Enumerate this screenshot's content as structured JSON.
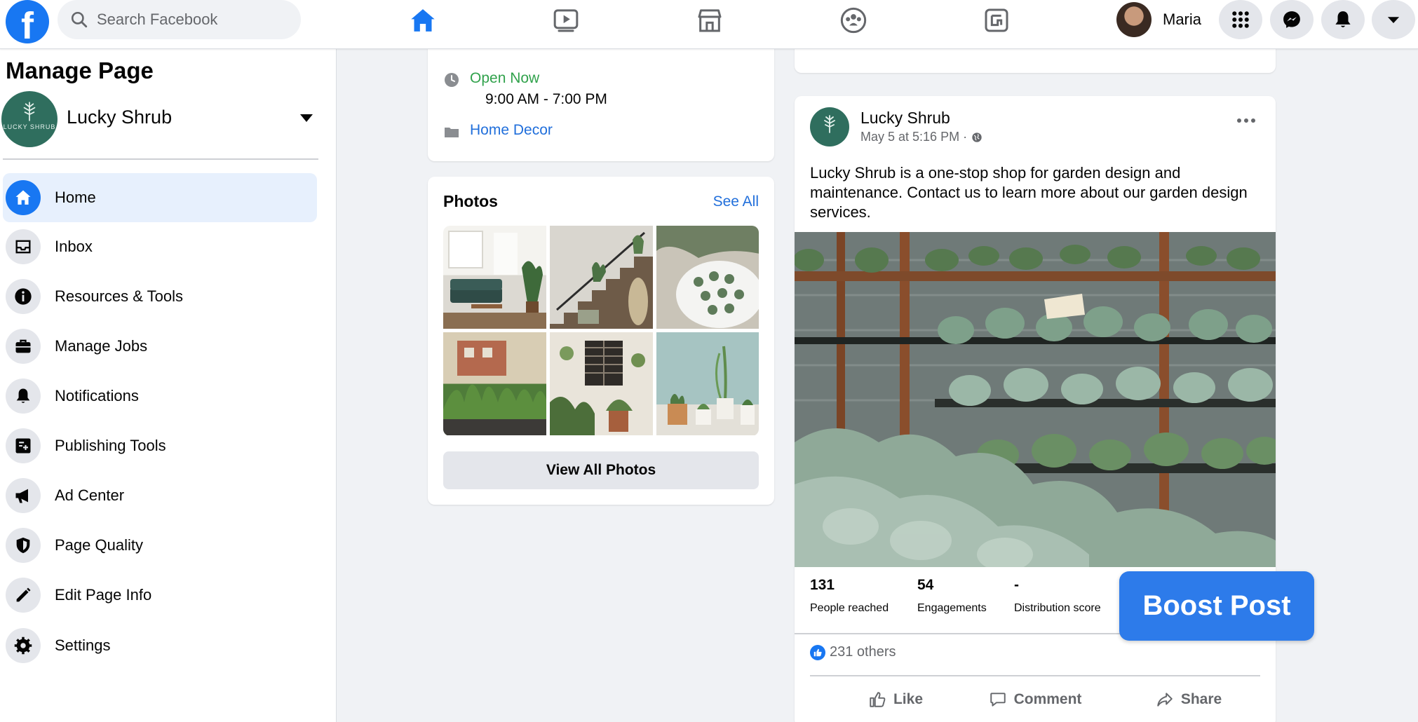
{
  "topbar": {
    "search_placeholder": "Search Facebook",
    "profile_name": "Maria"
  },
  "sidebar": {
    "title": "Manage Page",
    "page_name": "Lucky Shrub",
    "page_logo_text": "LUCKY SHRUB",
    "items": [
      {
        "label": "Home",
        "icon": "home-icon",
        "active": true
      },
      {
        "label": "Inbox",
        "icon": "inbox-icon"
      },
      {
        "label": "Resources & Tools",
        "icon": "info-icon"
      },
      {
        "label": "Manage Jobs",
        "icon": "briefcase-icon"
      },
      {
        "label": "Notifications",
        "icon": "bell-icon"
      },
      {
        "label": "Publishing Tools",
        "icon": "publishing-icon"
      },
      {
        "label": "Ad Center",
        "icon": "megaphone-icon"
      },
      {
        "label": "Page Quality",
        "icon": "shield-icon"
      },
      {
        "label": "Edit Page Info",
        "icon": "pencil-icon"
      },
      {
        "label": "Settings",
        "icon": "gear-icon"
      }
    ]
  },
  "about": {
    "status": "Open Now",
    "hours": "9:00 AM - 7:00 PM",
    "category": "Home Decor"
  },
  "photos": {
    "title": "Photos",
    "see_all": "See All",
    "view_all": "View All Photos"
  },
  "post": {
    "author": "Lucky Shrub",
    "time": "May 5 at 5:16 PM ·",
    "text": "Lucky Shrub is a one-stop shop for garden design and maintenance. Contact us to learn more about our garden design services.",
    "stats": [
      {
        "value": "131",
        "label": "People reached"
      },
      {
        "value": "54",
        "label": "Engagements"
      },
      {
        "value": "-",
        "label": "Distribution score"
      }
    ],
    "reactions": "231 others",
    "actions": {
      "like": "Like",
      "comment": "Comment",
      "share": "Share"
    },
    "boost_label": "Boost Post"
  },
  "colors": {
    "brand": "#1877f2",
    "boost": "#2d7bea",
    "open_now": "#31a24c",
    "link": "#216fdb",
    "active_bg": "#e7f0fd"
  }
}
